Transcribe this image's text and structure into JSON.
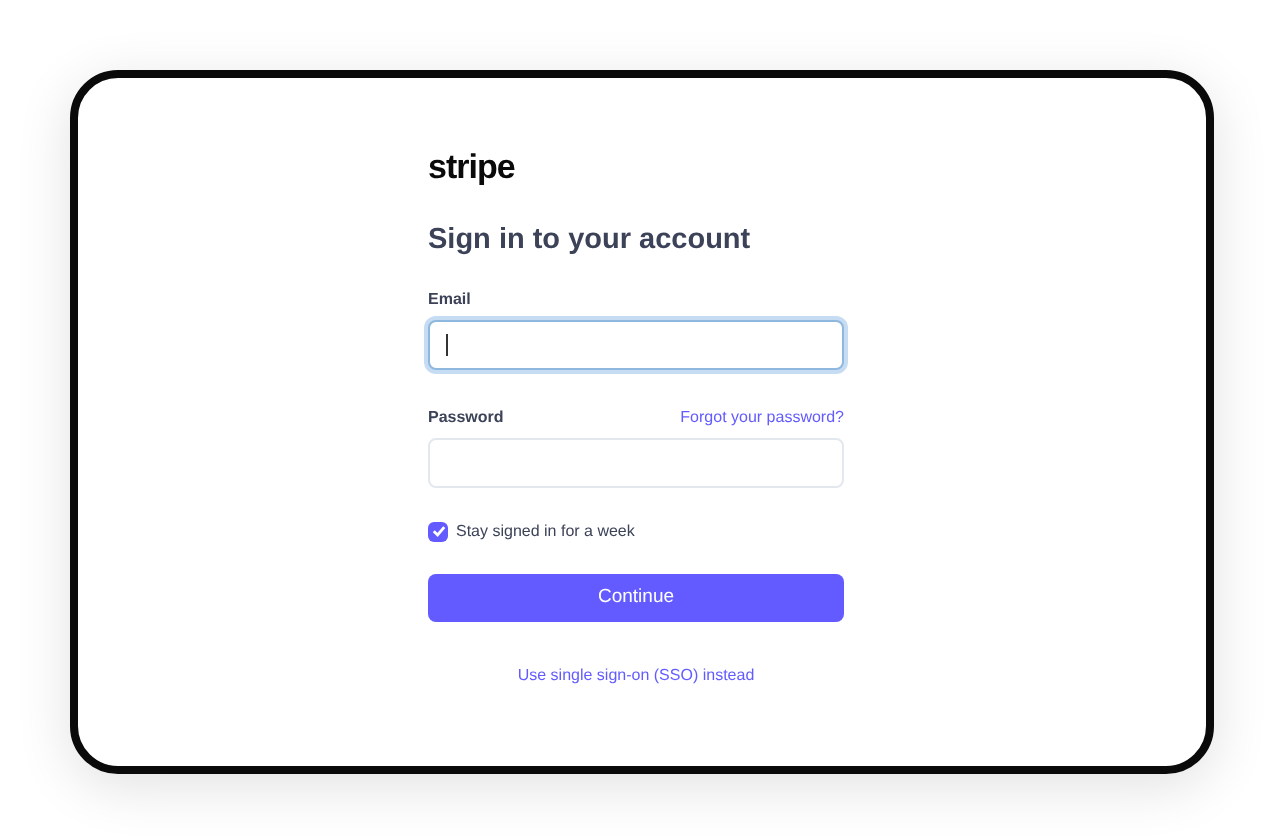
{
  "logo": "stripe",
  "title": "Sign in to your account",
  "email": {
    "label": "Email",
    "focused": true
  },
  "password": {
    "label": "Password",
    "link": "Forgot your password?"
  },
  "remember": {
    "label": "Stay signed in for a week",
    "checked": true
  },
  "submit": "Continue",
  "sso_link": "Use single sign-on (SSO) instead"
}
